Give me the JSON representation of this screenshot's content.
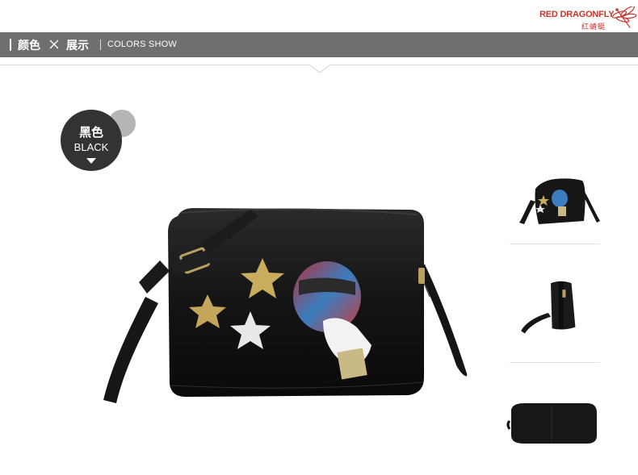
{
  "brand": {
    "name": "RED DRAGONFLY",
    "chinese": "红蜻蜓",
    "color": "#c8352a"
  },
  "title_bar": {
    "cn_left": "颜色",
    "cn_right": "展示",
    "en": "COLORS SHOW",
    "bg_color": "#6f6f6f"
  },
  "color_badge": {
    "cn": "黑色",
    "en": "BLACK"
  },
  "photos": {
    "main": "black-crossbody-bag-with-star-and-balloon-patches",
    "thumbnails": [
      "bag-front-angle",
      "bag-side-view",
      "bag-bottom-view"
    ]
  }
}
